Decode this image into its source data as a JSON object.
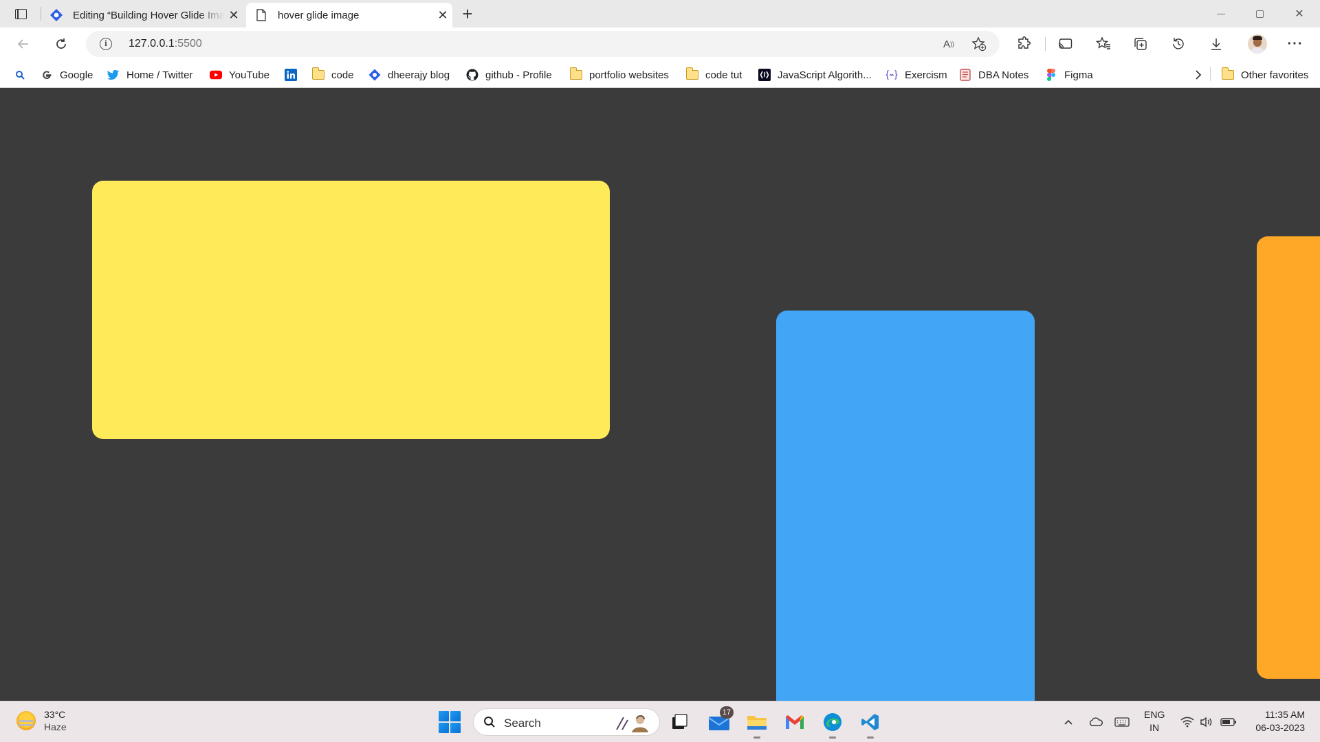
{
  "browser": {
    "tabs": [
      {
        "title": "Editing “Building Hover Glide Image",
        "favicon": "wordpress-edit-icon",
        "active": false
      },
      {
        "title": "hover glide image",
        "favicon": "page-icon",
        "active": true
      }
    ],
    "address": {
      "host": "127.0.0.1",
      "port": ":5500"
    },
    "favorites": [
      {
        "label": "Google",
        "icon": "google-icon"
      },
      {
        "label": "Home / Twitter",
        "icon": "twitter-icon"
      },
      {
        "label": "YouTube",
        "icon": "youtube-icon"
      },
      {
        "label": "",
        "icon": "linkedin-icon"
      },
      {
        "label": "code",
        "icon": "folder-icon"
      },
      {
        "label": "dheerajy blog",
        "icon": "blog-icon"
      },
      {
        "label": "github - Profile",
        "icon": "github-icon"
      },
      {
        "label": "portfolio websites",
        "icon": "folder-icon"
      },
      {
        "label": "code tut",
        "icon": "folder-icon"
      },
      {
        "label": "JavaScript Algorith...",
        "icon": "freecodecamp-icon"
      },
      {
        "label": "Exercism",
        "icon": "exercism-icon"
      },
      {
        "label": "DBA Notes",
        "icon": "notes-icon"
      },
      {
        "label": "Figma",
        "icon": "figma-icon"
      }
    ],
    "other_favorites": "Other favorites"
  },
  "page": {
    "cards": [
      {
        "color": "#ffeb5a"
      },
      {
        "color": "#42a5f5"
      },
      {
        "color": "#ffa726"
      }
    ]
  },
  "taskbar": {
    "weather": {
      "temp": "33°C",
      "condition": "Haze"
    },
    "search_label": "Search",
    "mail_badge": "17",
    "language": {
      "line1": "ENG",
      "line2": "IN"
    },
    "clock": {
      "time": "11:35 AM",
      "date": "06-03-2023"
    }
  }
}
